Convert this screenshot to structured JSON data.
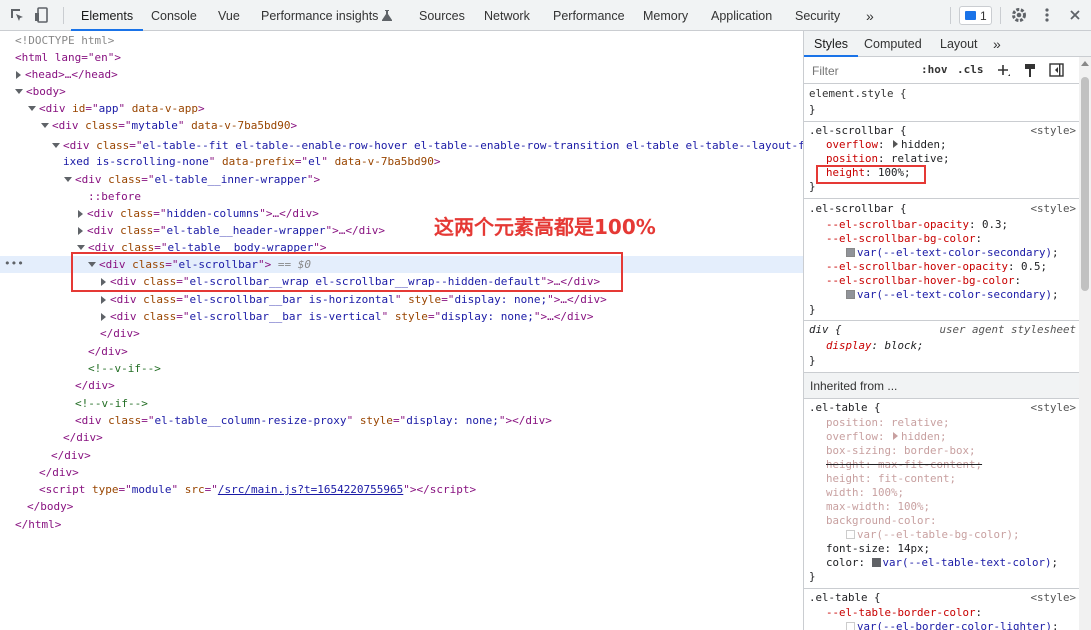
{
  "toolbar": {
    "tabs": [
      "Elements",
      "Console",
      "Vue",
      "Performance insights",
      "Sources",
      "Network",
      "Performance",
      "Memory",
      "Application",
      "Security"
    ],
    "more": "»",
    "issues_count": "1"
  },
  "tree": {
    "doctype": "<!DOCTYPE html>",
    "html_open": "<html lang=\"en\">",
    "head": "<head>…</head>",
    "body_open": "<body>",
    "app": {
      "tag": "div",
      "attr": "id",
      "val": "app",
      "extra": "data-v-app"
    },
    "mytable": {
      "tag": "div",
      "attr": "class",
      "val": "mytable",
      "extra": "data-v-7ba5bd90"
    },
    "eltable_line1": "el-table--fit el-table--enable-row-hover el-table--enable-row-transition el-table el-table--layout-f",
    "eltable_line2": "ixed is-scrolling-none",
    "eltable_prefix_attr": "data-prefix",
    "eltable_prefix_val": "el",
    "eltable_extra": "data-v-7ba5bd90",
    "inner_wrapper": "el-table__inner-wrapper",
    "before": "::before",
    "hidden_columns": "hidden-columns",
    "header_wrapper": "el-table__header-wrapper",
    "body_wrapper": "el-table__body-wrapper",
    "scrollbar": "el-scrollbar",
    "selected_marker": "== $0",
    "wrap": "el-scrollbar__wrap el-scrollbar__wrap--hidden-default",
    "bar_h": "el-scrollbar__bar is-horizontal",
    "bar_v": "el-scrollbar__bar is-vertical",
    "style_none": "display: none;",
    "vif": "<!--v-if-->",
    "resize_proxy": "el-table__column-resize-proxy",
    "script_type": "module",
    "script_src": "/src/main.js?t=1654220755965",
    "body_close": "</body>",
    "html_close": "</html>",
    "dots": "•••"
  },
  "annotation": "这两个元素高都是100%",
  "styles": {
    "tabs": [
      "Styles",
      "Computed",
      "Layout"
    ],
    "more": "»",
    "filter_placeholder": "Filter",
    "hov": ":hov",
    "cls": ".cls",
    "element_style": "element.style {",
    "brace_close": "}",
    "origin": "<style>",
    "rule1_selector": ".el-scrollbar {",
    "rule1": [
      {
        "p": "overflow",
        "v": "hidden"
      },
      {
        "p": "position",
        "v": "relative"
      },
      {
        "p": "height",
        "v": "100%"
      }
    ],
    "rule2_selector": ".el-scrollbar {",
    "rule2": [
      {
        "p": "--el-scrollbar-opacity",
        "v": "0.3"
      },
      {
        "p": "--el-scrollbar-bg-color",
        "v": ""
      },
      {
        "p": "",
        "v": "var(--el-text-color-secondary)"
      },
      {
        "p": "--el-scrollbar-hover-opacity",
        "v": "0.5"
      },
      {
        "p": "--el-scrollbar-hover-bg-color",
        "v": ""
      },
      {
        "p": "",
        "v": "var(--el-text-color-secondary)"
      }
    ],
    "ua_selector": "div {",
    "ua_origin": "user agent stylesheet",
    "ua_prop": "display",
    "ua_val": "block",
    "inherited": "Inherited from ...",
    "rule3_selector": ".el-table {",
    "rule3": [
      {
        "p": "position",
        "v": "relative"
      },
      {
        "p": "overflow",
        "v": "hidden"
      },
      {
        "p": "box-sizing",
        "v": "border-box"
      },
      {
        "p": "height",
        "v": "max-fit-content"
      },
      {
        "p": "height",
        "v": "fit-content"
      },
      {
        "p": "width",
        "v": "100%"
      },
      {
        "p": "max-width",
        "v": "100%"
      },
      {
        "p": "background-color",
        "v": ""
      },
      {
        "p": "",
        "v": "var(--el-table-bg-color)"
      },
      {
        "p": "font-size",
        "v": "14px"
      },
      {
        "p": "color",
        "v": "var(--el-table-text-color)"
      }
    ],
    "rule4_selector": ".el-table {",
    "rule4": [
      {
        "p": "--el-table-border-color",
        "v": ""
      },
      {
        "p": "",
        "v": "var(--el-border-color-lighter)"
      }
    ]
  },
  "colors": {
    "accent": "#1a73e8",
    "annotation": "#e53935",
    "selection": "#e4eefc"
  },
  "icons": [
    "inspect-icon",
    "device-toggle-icon",
    "issues-icon",
    "settings-icon",
    "more-vert-icon",
    "new-rule-icon",
    "paint-icon",
    "sidebar-toggle-icon"
  ]
}
